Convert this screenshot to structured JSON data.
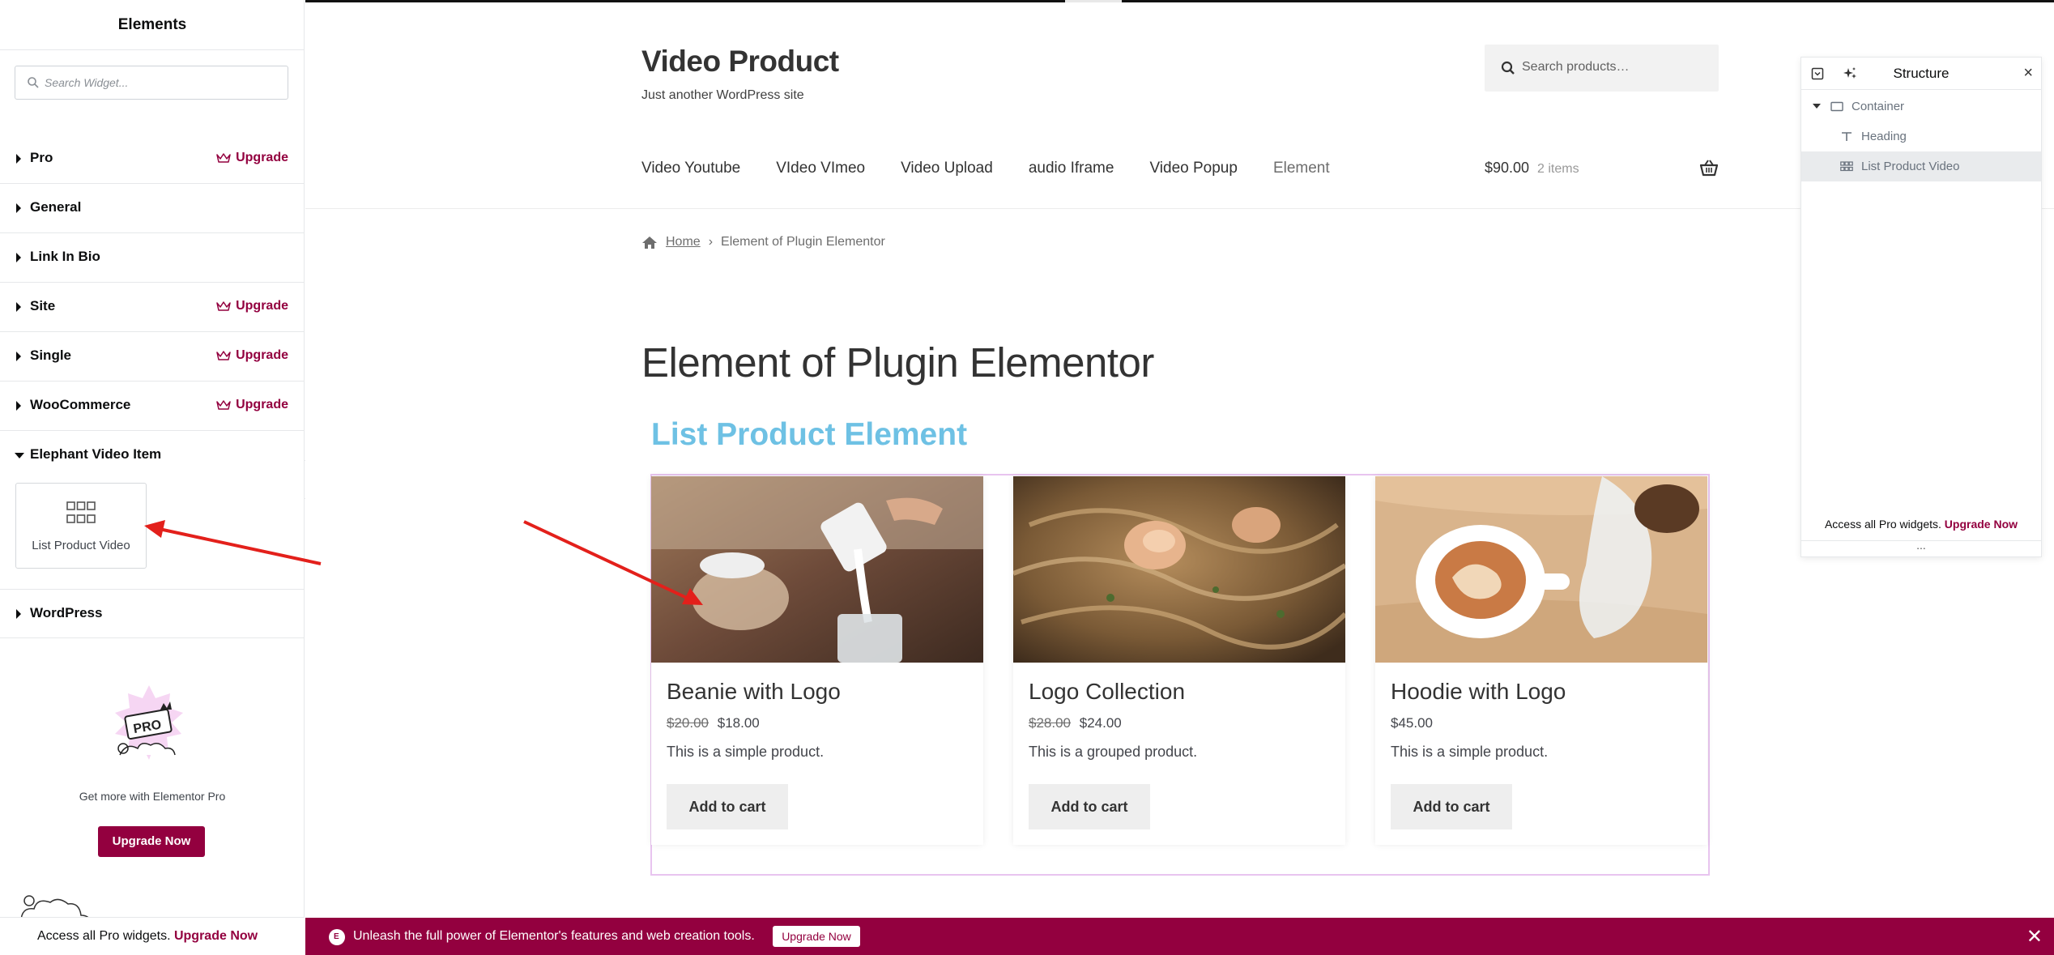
{
  "elements_panel": {
    "title": "Elements",
    "search_placeholder": "Search Widget...",
    "upgrade_label": "Upgrade",
    "categories": [
      {
        "label": "Pro",
        "upgrade": true
      },
      {
        "label": "General",
        "upgrade": false
      },
      {
        "label": "Link In Bio",
        "upgrade": false
      },
      {
        "label": "Site",
        "upgrade": true
      },
      {
        "label": "Single",
        "upgrade": true
      },
      {
        "label": "WooCommerce",
        "upgrade": true
      },
      {
        "label": "Elephant Video Item",
        "upgrade": false,
        "expanded": true
      },
      {
        "label": "WordPress",
        "upgrade": false
      }
    ],
    "widget": {
      "label": "List Product Video",
      "icon": "grid-icon"
    },
    "promo": {
      "badge_text": "PRO",
      "text": "Get more with Elementor Pro",
      "button": "Upgrade Now"
    },
    "footer": {
      "text": "Access all Pro widgets.",
      "link": "Upgrade Now"
    }
  },
  "site": {
    "title": "Video Product",
    "tagline": "Just another WordPress site",
    "search_placeholder": "Search products…",
    "nav": [
      "Video Youtube",
      "VIdeo VImeo",
      "Video Upload",
      "audio Iframe",
      "Video Popup",
      "Element"
    ],
    "cart": {
      "total": "$90.00",
      "count": "2 items"
    },
    "breadcrumb": {
      "home": "Home",
      "current": "Element of Plugin Elementor"
    },
    "page_title": "Element of Plugin Elementor",
    "list_heading": "List Product Element",
    "products": [
      {
        "name": "Beanie with Logo",
        "old_price": "$20.00",
        "price": "$18.00",
        "description": "This is a simple product.",
        "button": "Add to cart"
      },
      {
        "name": "Logo Collection",
        "old_price": "$28.00",
        "price": "$24.00",
        "description": "This is a grouped product.",
        "button": "Add to cart"
      },
      {
        "name": "Hoodie with Logo",
        "old_price": "",
        "price": "$45.00",
        "description": "This is a simple product.",
        "button": "Add to cart"
      }
    ]
  },
  "structure_panel": {
    "title": "Structure",
    "nodes": [
      {
        "label": "Container",
        "icon": "container-icon"
      },
      {
        "label": "Heading",
        "icon": "heading-icon"
      },
      {
        "label": "List Product Video",
        "icon": "grid-icon",
        "active": true
      }
    ],
    "footer": {
      "text": "Access all Pro widgets.",
      "link": "Upgrade Now"
    },
    "dots": "..."
  },
  "promo_bar": {
    "logo": "E",
    "message": "Unleash the full power of Elementor's features and web creation tools.",
    "button": "Upgrade Now",
    "close": "✕"
  },
  "colors": {
    "brand": "#93003f",
    "heading_blue": "#6ec1e4",
    "annotation_red": "#e3201b"
  }
}
